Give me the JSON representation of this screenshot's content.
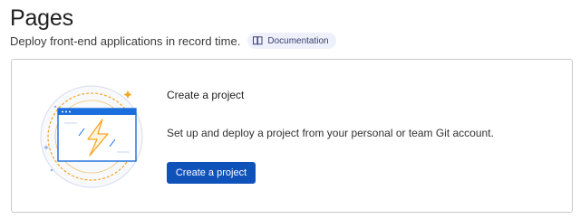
{
  "header": {
    "title": "Pages",
    "subtitle": "Deploy front-end applications in record time.",
    "doc_badge": {
      "label": "Documentation",
      "icon": "book-icon"
    }
  },
  "card": {
    "title": "Create a project",
    "description": "Set up and deploy a project from your personal or team Git account.",
    "button_label": "Create a project",
    "illustration_icon": "lightning-window-icon"
  },
  "colors": {
    "primary_button": "#0f52ba",
    "badge_bg": "#eef0fb",
    "illustration_blue": "#1a6ddc",
    "illustration_orange": "#f5a623"
  }
}
